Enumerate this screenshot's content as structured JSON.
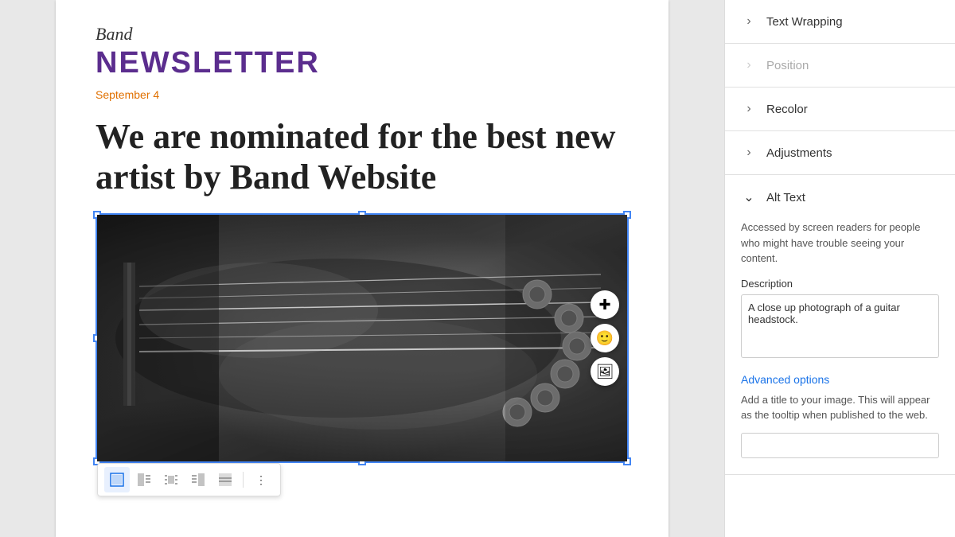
{
  "document": {
    "band_script": "Band",
    "band_block": "NEWSLETTER",
    "date": "September 4",
    "headline": "We are nominated for the best new artist by Band Website",
    "image_alt": "Close up photograph of a guitar headstock"
  },
  "image_actions": {
    "add_icon": "＋",
    "emoji_icon": "🙂",
    "image_icon": "🖼"
  },
  "toolbar": {
    "buttons": [
      {
        "id": "wrap-none",
        "label": "■",
        "title": "Wrap none",
        "active": true
      },
      {
        "id": "wrap-left",
        "label": "▤",
        "title": "Wrap left"
      },
      {
        "id": "wrap-center",
        "label": "▣",
        "title": "Wrap center"
      },
      {
        "id": "wrap-right",
        "label": "▤",
        "title": "Wrap right"
      },
      {
        "id": "wrap-break",
        "label": "▥",
        "title": "Break text"
      }
    ],
    "more_icon": "⋮"
  },
  "right_panel": {
    "sections": [
      {
        "id": "text-wrapping",
        "label": "Text Wrapping",
        "expanded": false,
        "dimmed": false
      },
      {
        "id": "position",
        "label": "Position",
        "expanded": false,
        "dimmed": true
      },
      {
        "id": "recolor",
        "label": "Recolor",
        "expanded": false,
        "dimmed": false
      },
      {
        "id": "adjustments",
        "label": "Adjustments",
        "expanded": false,
        "dimmed": false
      }
    ],
    "alt_text": {
      "label": "Alt Text",
      "description": "Accessed by screen readers for people who might have trouble seeing your content.",
      "description_field_label": "Description",
      "description_value": "A close up photograph of a guitar headstock.",
      "advanced_options_label": "Advanced options",
      "advanced_description": "Add a title to your image. This will appear as the tooltip when published to the web.",
      "title_value": ""
    }
  }
}
